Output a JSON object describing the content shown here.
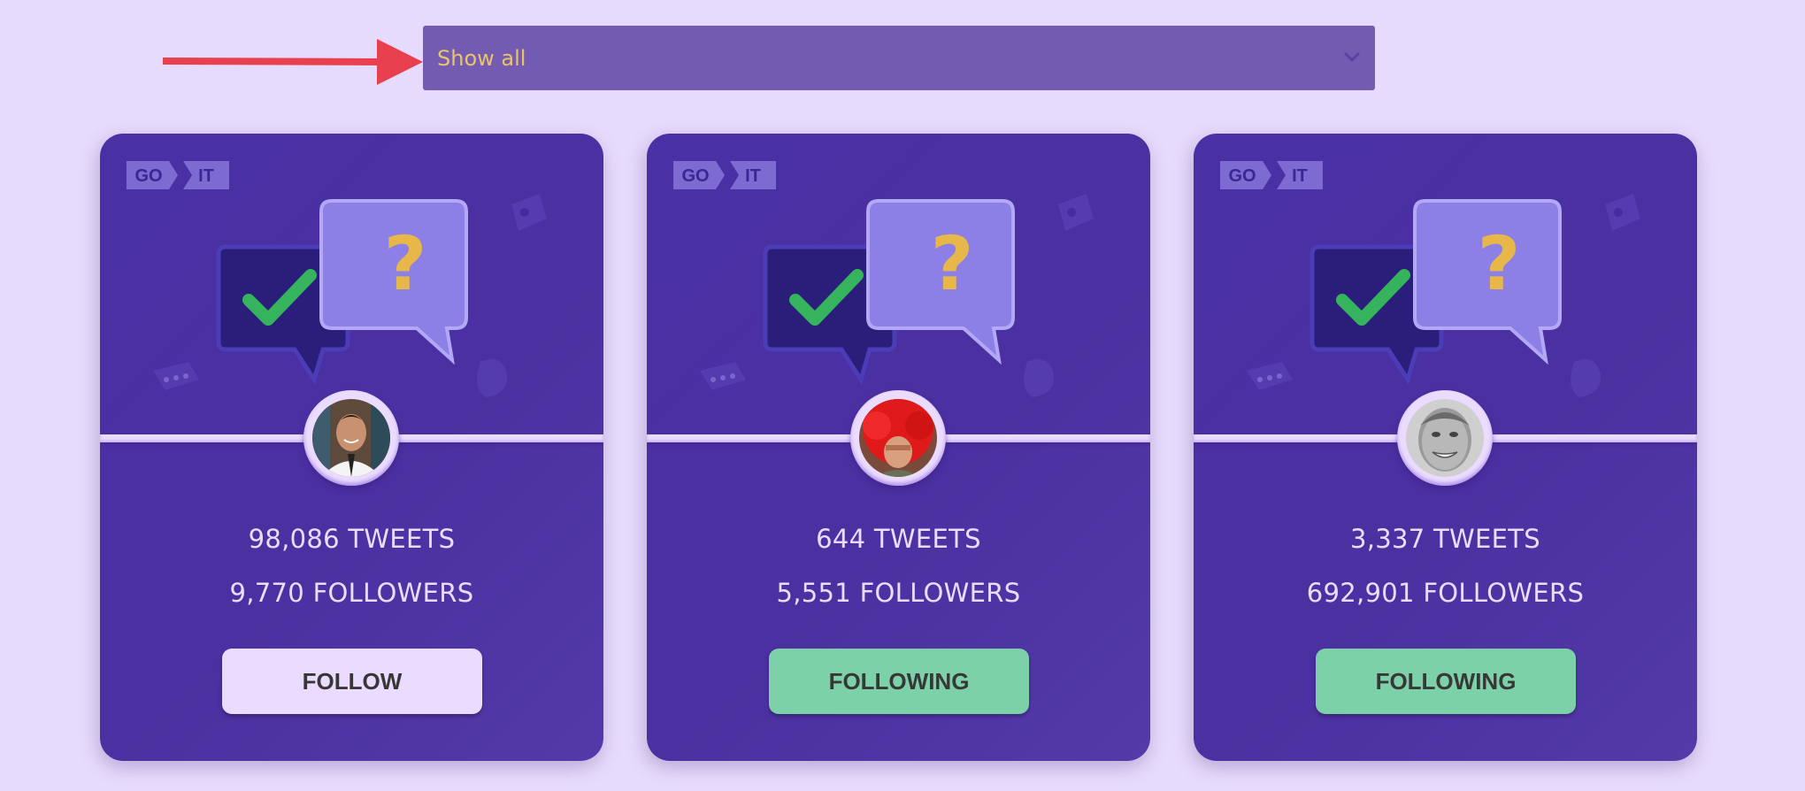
{
  "filter": {
    "value": "Show all",
    "icon": "chevron-down-icon"
  },
  "colors": {
    "page_bg": "#e7dbfd",
    "filter_bg": "#735bb2",
    "filter_text": "#e9c46a",
    "card_bg": "#4930a5",
    "follow_button": "#ebdcff",
    "following_button": "#7cd1a8",
    "annotation_arrow": "#e8404f"
  },
  "cards": [
    {
      "logo": {
        "part1": "GO",
        "part2": "IT"
      },
      "tweets": "98,086 TWEETS",
      "followers": "9,770 FOLLOWERS",
      "button": "FOLLOW",
      "state": "follow"
    },
    {
      "logo": {
        "part1": "GO",
        "part2": "IT"
      },
      "tweets": "644 TWEETS",
      "followers": "5,551 FOLLOWERS",
      "button": "FOLLOWING",
      "state": "following"
    },
    {
      "logo": {
        "part1": "GO",
        "part2": "IT"
      },
      "tweets": "3,337 TWEETS",
      "followers": "692,901 FOLLOWERS",
      "button": "FOLLOWING",
      "state": "following"
    }
  ]
}
